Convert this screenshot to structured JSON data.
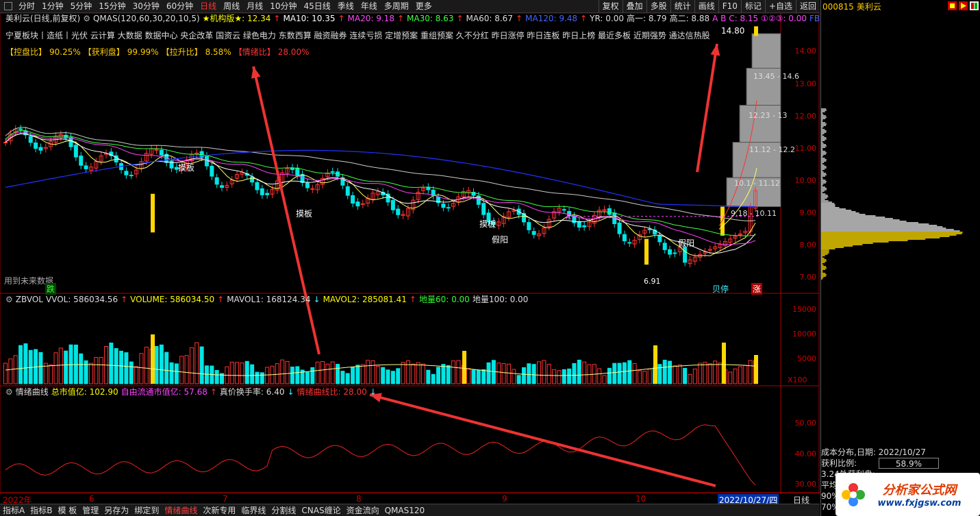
{
  "toolbar": {
    "periods": [
      "分时",
      "1分钟",
      "5分钟",
      "15分钟",
      "30分钟",
      "60分钟",
      "日线",
      "周线",
      "月线",
      "10分钟",
      "45日线",
      "季线",
      "年线",
      "多周期",
      "更多"
    ],
    "active_period": "日线",
    "right_buttons": [
      "复权",
      "叠加",
      "多股",
      "统计",
      "画线",
      "F10",
      "标记",
      "+自选",
      "返回"
    ]
  },
  "stock": {
    "code": "000815",
    "name": "美利云"
  },
  "main_info": {
    "title": "美利云(日线,前复权)",
    "qmas": "QMAS(120,60,30,20,10,5)",
    "jgb": "★机构版★: 12.34",
    "ma10": "MA10: 10.35",
    "ma20": "MA20: 9.18",
    "ma30": "MA30: 8.63",
    "ma60": "MA60: 8.67",
    "ma120": "MA120: 9.48",
    "yr": "YR: 0.00",
    "g1": "高一: 8.79",
    "g2": "高二: 8.88",
    "abc": "A B C: 8.15",
    "circ": "①②③: 0.00",
    "fbi": "FBi"
  },
  "sectors": "宁夏板块丨造纸丨光伏 云计算 大数据 数据中心 央企改革 国资云 绿色电力 东数西算 融资融券 连续亏损 定增预案 重组预案 久不分红 昨日涨停 昨日连板 昨日上榜 最近多板 近期强势 通达信热股",
  "ratios": {
    "kp_label": "【控盘比】",
    "kp_val": "90.25%",
    "hl_label": "【获利盘】",
    "hl_val": "99.99%",
    "ls_label": "【拉升比】",
    "ls_val": "8.58%",
    "qx_label": "【情绪比】",
    "qx_val": "28.00%"
  },
  "price_axis": [
    "14.00",
    "13.00",
    "12.00",
    "11.00",
    "10.00",
    "9.00",
    "8.00",
    "7.00"
  ],
  "chips": [
    "13.45 - 14.6",
    "12.23 - 13",
    "11.12 - 12.2",
    "10.1 - 11.12",
    "9.18 - 10.11"
  ],
  "peak_label": "14.80",
  "low_label": "6.91",
  "notes": {
    "future": "用到未来数据",
    "die": "跌",
    "zhang": "涨",
    "baoting": "贝停",
    "mb1": "摸板",
    "mb2": "摸板",
    "mb3": "摸板",
    "jy1": "假阳",
    "jy2": "假阳",
    "mark_a": "A"
  },
  "vol_info": {
    "name": "ZBVOL",
    "vvol": "VVOL: 586034.56",
    "volume": "VOLUME: 586034.50",
    "mavol1": "MAVOL1: 168124.34",
    "mavol2": "MAVOL2: 285081.41",
    "dl60": "地量60: 0.00",
    "dl100": "地量100: 0.00"
  },
  "vol_axis": [
    "15000",
    "10000",
    "5000"
  ],
  "vol_unit": "X100",
  "mood_info": {
    "name": "情绪曲线",
    "zsz": "总市值亿: 102.90",
    "ltsz": "自由流通市值亿: 57.68",
    "hsl": "真价换手率: 6.40",
    "qxb": "情绪曲线比: 28.00"
  },
  "mood_axis": [
    "50.00",
    "40.00",
    "30.00"
  ],
  "date_axis": [
    "2022年",
    "6",
    "7",
    "8",
    "9",
    "10"
  ],
  "date_current": "2022/10/27/四",
  "date_period": "日线",
  "bottom_tabs": [
    "指标A",
    "指标B",
    "模 板",
    "管理",
    "另存为",
    "绑定到",
    "情绪曲线",
    "次新专用",
    "临界线",
    "分割线",
    "CNAS缠论",
    "资金流向",
    "QMAS120"
  ],
  "active_tab": "情绪曲线",
  "cost": {
    "title": "成本分布,日期: 2022/10/27",
    "profit_label": "获利比例:",
    "profit_val": "58.9%",
    "line3": "3.24处获利盘:",
    "line4": "平均",
    "line5": "90%",
    "line6": "70%"
  },
  "watermark": {
    "site": "分析家公式网",
    "url": "www.fxjgsw.com"
  },
  "colors": {
    "up": "#ff3333",
    "down": "#00e5e5",
    "accent": "#ffff00",
    "ma120": "#0000ff"
  }
}
